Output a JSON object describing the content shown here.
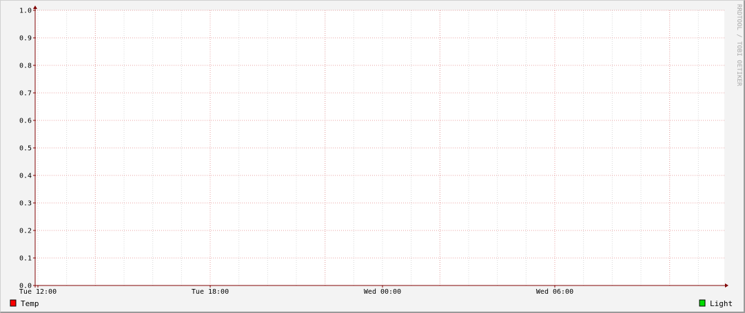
{
  "chart_data": {
    "type": "line",
    "ylim": [
      0,
      1.0
    ],
    "y_ticks": [
      "0.0",
      "0.1",
      "0.2",
      "0.3",
      "0.4",
      "0.5",
      "0.6",
      "0.7",
      "0.8",
      "0.9",
      "1.0"
    ],
    "x_tick_labels": [
      "Tue 12:00",
      "Tue 18:00",
      "Wed 00:00",
      "Wed 06:00"
    ],
    "series": [
      {
        "name": "Temp",
        "color": "#ff0000",
        "values": []
      },
      {
        "name": "Light",
        "color": "#00dd00",
        "values": []
      }
    ],
    "grid": true,
    "legend": "bottom",
    "watermark": "RRDTOOL / TOBI OETIKER",
    "colors": {
      "canvas": "#ffffff",
      "background": "#f3f3f3",
      "major_grid": "#e8a0a0",
      "minor_grid": "#d8d8d8",
      "axis": "#800000"
    }
  }
}
